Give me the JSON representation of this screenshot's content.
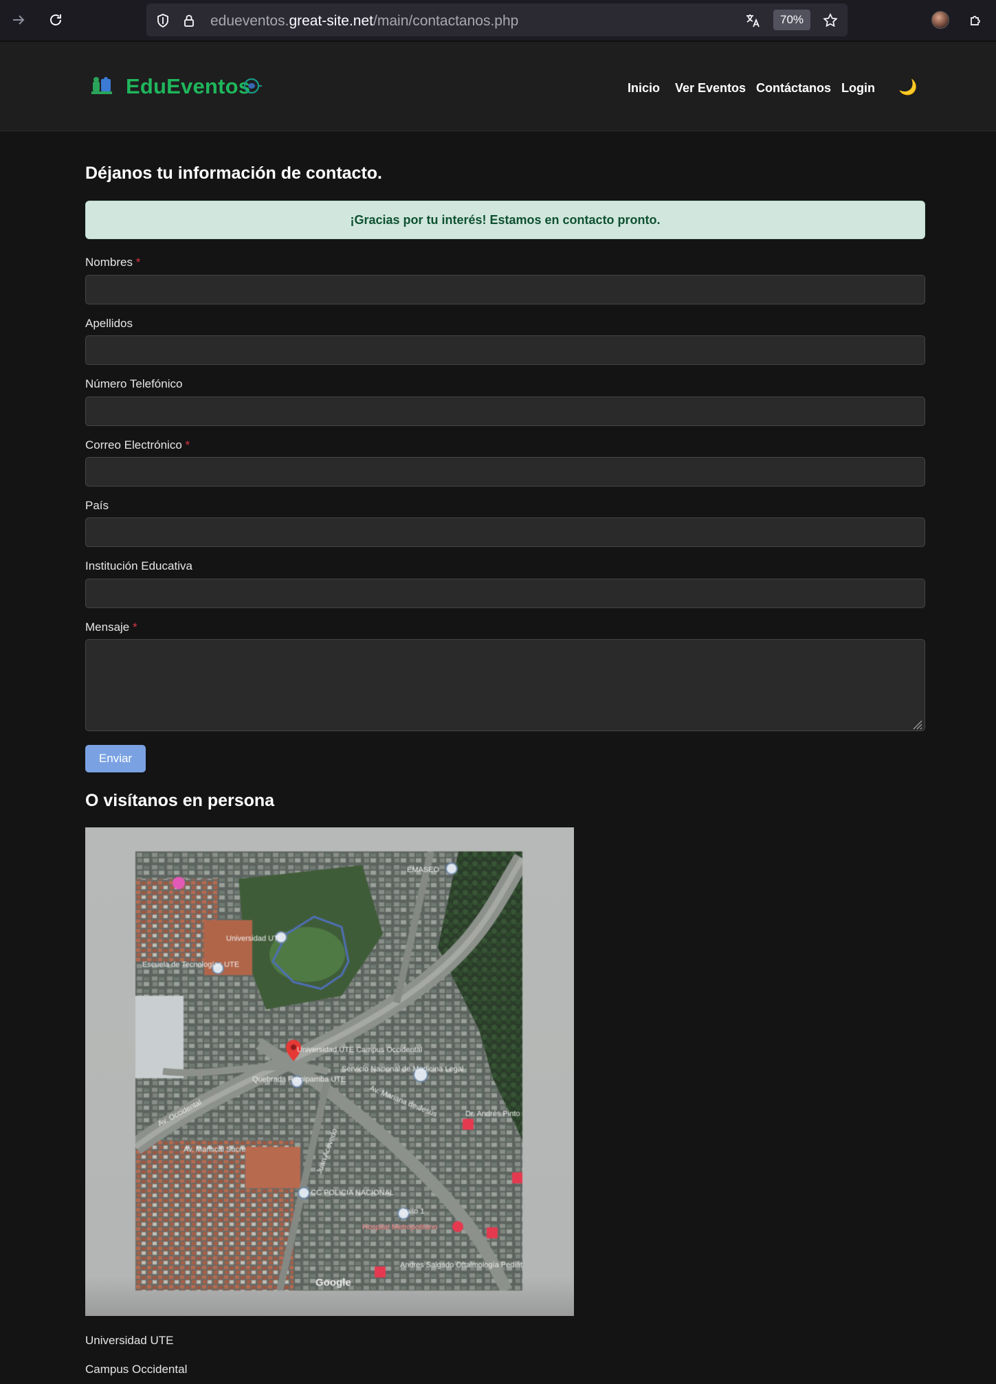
{
  "browser": {
    "url_prefix": "edueventos.",
    "url_domain": "great-site.net",
    "url_path": "/main/contactanos.php",
    "zoom": "70%"
  },
  "header": {
    "logo_text": "EduEventos",
    "nav": [
      {
        "label": "Inicio"
      },
      {
        "label": "Ver Eventos"
      },
      {
        "label": "Contáctanos"
      },
      {
        "label": "Login"
      }
    ],
    "theme_icon": "🌙"
  },
  "main": {
    "title": "Déjanos tu información de contacto.",
    "alert": "¡Gracias por tu interés! Estamos en contacto pronto.",
    "fields": {
      "nombres": {
        "label": "Nombres",
        "required": "*",
        "value": ""
      },
      "apellidos": {
        "label": "Apellidos",
        "value": ""
      },
      "telefono": {
        "label": "Número Telefónico",
        "value": ""
      },
      "correo": {
        "label": "Correo Electrónico",
        "required": "*",
        "value": ""
      },
      "pais": {
        "label": "País",
        "value": ""
      },
      "institucion": {
        "label": "Institución Educativa",
        "value": ""
      },
      "mensaje": {
        "label": "Mensaje",
        "required": "*",
        "value": ""
      }
    },
    "submit_label": "Enviar",
    "visit_title": "O visítanos en persona",
    "map": {
      "place_label": "Universidad UTE Campus Occidental",
      "labels": [
        "EMASEO",
        "Universidad UTE",
        "Escuela de Tecnologías UTE",
        "Quebrada Rumipamba UTE",
        "Servicio Nacional de Medicina Legal",
        "Av. Mariscal Sucre",
        "Av. Occidental",
        "Av. Mariana de Jesús",
        "Juan Acevedo",
        "CC POLICIA NACIONAL",
        "Hospital Metropolitano",
        "Quito 1",
        "Andres Salgado Oftalmología Pediátrica",
        "Dr. Andrés Pinto",
        "Google"
      ]
    },
    "address": [
      "Universidad UTE",
      "Campus Occidental"
    ]
  },
  "colors": {
    "brand_green": "#1fb65c",
    "alert_bg": "#d1e7dd",
    "alert_text": "#0f5132",
    "button": "#7aa2e3",
    "required": "#dc3545"
  }
}
